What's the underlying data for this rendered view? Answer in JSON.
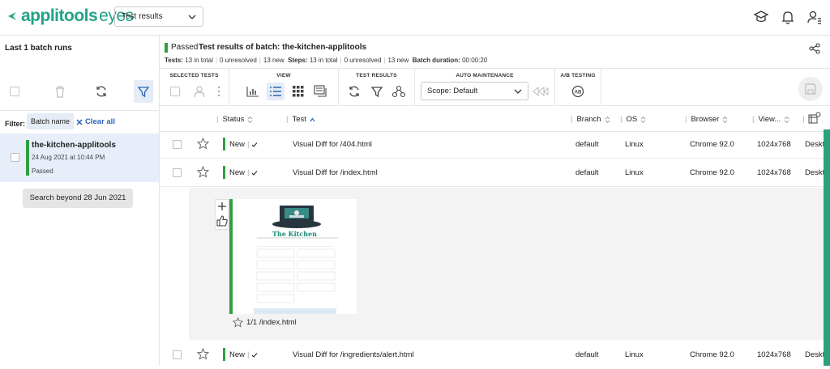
{
  "app": {
    "brand_bold": "applitools",
    "brand_light": "eyes",
    "view_selector": "Test results"
  },
  "left_panel": {
    "title": "Last 1 batch runs",
    "filter_label": "Filter:",
    "filter_chip": "Batch name",
    "clear_all": "Clear all",
    "batch": {
      "name": "the-kitchen-applitools",
      "date": "24 Aug 2021 at 10:44 PM",
      "status": "Passed"
    },
    "search_beyond": "Search beyond 28 Jun 2021"
  },
  "header": {
    "status": "Passed",
    "title": "Test results of batch:  the-kitchen-applitools",
    "tests_label": "Tests:",
    "tests_total": "13 in total",
    "tests_unresolved": "0 unresolved",
    "tests_new": "13 new",
    "steps_label": "Steps:",
    "steps_total": "13 in total",
    "steps_unresolved": "0 unresolved",
    "steps_new": "13 new",
    "duration_label": "Batch duration:",
    "duration": "00:00:20"
  },
  "toolbar": {
    "selected_tests": "SELECTED TESTS",
    "view": "VIEW",
    "test_results": "TEST RESULTS",
    "auto_maintenance": "AUTO MAINTENANCE",
    "ab_testing": "A/B TESTING",
    "scope": "Scope: Default"
  },
  "table": {
    "columns": {
      "status": "Status",
      "test": "Test",
      "branch": "Branch",
      "os": "OS",
      "browser": "Browser",
      "viewport": "View...",
      "device": ""
    },
    "rows": [
      {
        "status": "New",
        "test": "Visual Diff for /404.html",
        "branch": "default",
        "os": "Linux",
        "browser": "Chrome 92.0",
        "viewport": "1024x768",
        "device": "Deskt"
      },
      {
        "status": "New",
        "test": "Visual Diff for /index.html",
        "branch": "default",
        "os": "Linux",
        "browser": "Chrome 92.0",
        "viewport": "1024x768",
        "device": "Deskt"
      },
      {
        "status": "New",
        "test": "Visual Diff for /ingredients/alert.html",
        "branch": "default",
        "os": "Linux",
        "browser": "Chrome 92.0",
        "viewport": "1024x768",
        "device": "Deskt"
      }
    ],
    "step_caption": "1/1 /index.html",
    "thumb_title": "The Kitchen"
  },
  "colors": {
    "brand": "#21a389",
    "passed": "#2ea043",
    "link": "#2a62b8",
    "selected_bg": "#e7eefa"
  }
}
